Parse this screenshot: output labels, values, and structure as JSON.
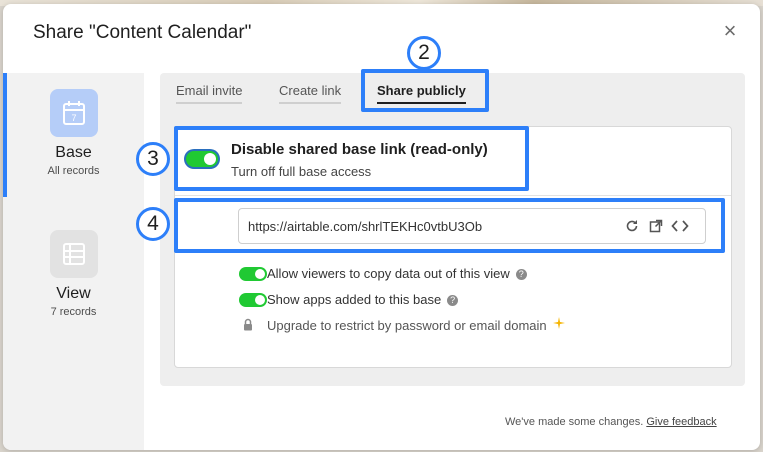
{
  "dialog": {
    "title": "Share \"Content Calendar\"",
    "close_label": "×"
  },
  "sidebar": {
    "items": [
      {
        "label": "Base",
        "sub": "All records",
        "icon": "calendar-icon",
        "icon_text": "7",
        "selected": true
      },
      {
        "label": "View",
        "sub": "7 records",
        "icon": "grid-list-icon",
        "selected": false
      }
    ]
  },
  "tabs": [
    {
      "label": "Email invite",
      "active": false
    },
    {
      "label": "Create link",
      "active": false
    },
    {
      "label": "Share publicly",
      "active": true
    }
  ],
  "share_toggle": {
    "title": "Disable shared base link (read-only)",
    "subtitle": "Turn off full base access",
    "enabled": true
  },
  "share_link": {
    "url": "https://airtable.com/shrlTEKHc0vtbU3Ob",
    "icons": [
      "refresh-icon",
      "open-external-icon",
      "embed-code-icon"
    ]
  },
  "options": [
    {
      "label": "Allow viewers to copy data out of this view",
      "type": "toggle",
      "enabled": true,
      "help": true
    },
    {
      "label": "Show apps added to this base",
      "type": "toggle",
      "enabled": true,
      "help": true
    },
    {
      "label": "Upgrade to restrict by password or email domain",
      "type": "locked",
      "icon": "lock-icon",
      "extra_icon": "sparkle-icon"
    }
  ],
  "footer": {
    "text": "We've made some changes.",
    "link": "Give feedback"
  },
  "annotations": {
    "badge_2": "2",
    "badge_3": "3",
    "badge_4": "4"
  },
  "colors": {
    "accent": "#2d7ff9",
    "toggle_on": "#20c933",
    "base_icon_bg": "#b5cdf8"
  }
}
